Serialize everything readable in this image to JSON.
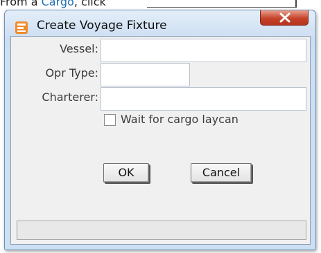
{
  "context": {
    "prefix": "From a ",
    "link": "Cargo",
    "suffix": ", click"
  },
  "dialog": {
    "title": "Create Voyage Fixture",
    "icon": "voyage-fixture-icon",
    "close_icon": "close-icon"
  },
  "form": {
    "vessel_label": "Vessel:",
    "vessel_value": "",
    "opr_type_label": "Opr Type:",
    "opr_type_value": "",
    "charterer_label": "Charterer:",
    "charterer_value": "",
    "wait_checkbox_label": "Wait for cargo laycan",
    "wait_checked": false
  },
  "buttons": {
    "ok_label": "OK",
    "cancel_label": "Cancel"
  },
  "colors": {
    "close_button": "#c6432a",
    "title_bar": "#cddff2",
    "link": "#1f6fb2"
  }
}
